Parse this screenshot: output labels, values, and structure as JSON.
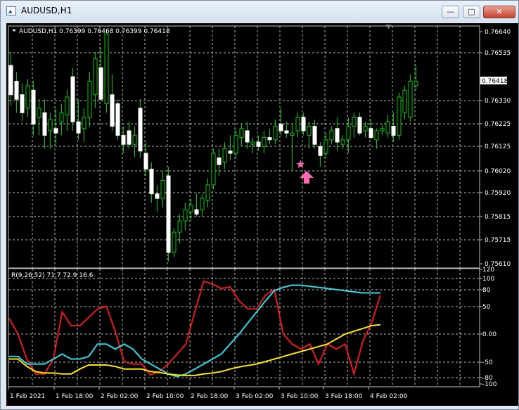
{
  "window": {
    "title": "AUDUSD,H1",
    "minimize_glyph": "—",
    "maximize_glyph": "□",
    "close_glyph": "✕"
  },
  "price_panel": {
    "header": "AUDUSD,H1  0.76399 0.76468 0.76399 0.76418",
    "price_ticks": [
      "0.76640",
      "0.76535",
      "0.76330",
      "0.76225",
      "0.76125",
      "0.76020",
      "0.75920",
      "0.75815",
      "0.75715",
      "0.75610"
    ],
    "current_price": "0.76418",
    "marker_icons": [
      "star-icon",
      "up-arrow-icon"
    ]
  },
  "indicator_panel": {
    "header": "R(9,26,52) 71.7 72.9 16.6",
    "ticks": [
      "120",
      "100",
      "80",
      "50",
      "0.00",
      "-50",
      "-80",
      "-100"
    ],
    "colors": {
      "fast": "#e41a1c",
      "medium": "#33d6e6",
      "slow": "#ffe600"
    }
  },
  "time_axis": [
    "1 Feb 2021",
    "1 Feb 18:00",
    "2 Feb 02:00",
    "2 Feb 10:00",
    "2 Feb 18:00",
    "3 Feb 02:00",
    "3 Feb 10:00",
    "3 Feb 18:00",
    "4 Feb 02:00"
  ],
  "chart_data": [
    {
      "type": "candlestick",
      "title": "AUDUSD,H1",
      "ylim": [
        0.7561,
        0.7664
      ],
      "open_high_low_close": [
        [
          0.7649,
          0.7655,
          0.7631,
          0.7636
        ],
        [
          0.7642,
          0.7646,
          0.7628,
          0.7634
        ],
        [
          0.7636,
          0.7641,
          0.7624,
          0.7628
        ],
        [
          0.763,
          0.7643,
          0.7626,
          0.764
        ],
        [
          0.7638,
          0.7642,
          0.7618,
          0.7623
        ],
        [
          0.7626,
          0.7634,
          0.7618,
          0.763
        ],
        [
          0.7628,
          0.7634,
          0.7612,
          0.7618
        ],
        [
          0.762,
          0.7628,
          0.7612,
          0.7625
        ],
        [
          0.7621,
          0.763,
          0.7614,
          0.7619
        ],
        [
          0.7624,
          0.7632,
          0.7618,
          0.7628
        ],
        [
          0.7627,
          0.7638,
          0.762,
          0.7635
        ],
        [
          0.7644,
          0.7648,
          0.762,
          0.7624
        ],
        [
          0.7624,
          0.7634,
          0.7616,
          0.7619
        ],
        [
          0.7621,
          0.763,
          0.7615,
          0.7626
        ],
        [
          0.7626,
          0.7646,
          0.7622,
          0.7642
        ],
        [
          0.7636,
          0.7655,
          0.763,
          0.7652
        ],
        [
          0.7648,
          0.7657,
          0.7633,
          0.7634
        ],
        [
          0.7632,
          0.7665,
          0.7628,
          0.7663
        ],
        [
          0.7636,
          0.7645,
          0.762,
          0.7622
        ],
        [
          0.7632,
          0.7634,
          0.7616,
          0.7618
        ],
        [
          0.7618,
          0.7622,
          0.761,
          0.7614
        ],
        [
          0.762,
          0.7624,
          0.7612,
          0.7614
        ],
        [
          0.7614,
          0.7622,
          0.7608,
          0.7618
        ],
        [
          0.763,
          0.7634,
          0.7608,
          0.7611
        ],
        [
          0.761,
          0.7615,
          0.76,
          0.7603
        ],
        [
          0.7603,
          0.7606,
          0.7588,
          0.7592
        ],
        [
          0.7592,
          0.7596,
          0.7584,
          0.759
        ],
        [
          0.759,
          0.7602,
          0.7586,
          0.7598
        ],
        [
          0.76,
          0.7604,
          0.7562,
          0.7566
        ],
        [
          0.7566,
          0.7577,
          0.7564,
          0.7575
        ],
        [
          0.7575,
          0.7583,
          0.757,
          0.758
        ],
        [
          0.758,
          0.7588,
          0.7576,
          0.7585
        ],
        [
          0.7584,
          0.759,
          0.758,
          0.7587
        ],
        [
          0.7585,
          0.7592,
          0.7582,
          0.7583
        ],
        [
          0.7585,
          0.7592,
          0.7582,
          0.759
        ],
        [
          0.7589,
          0.7599,
          0.7586,
          0.7596
        ],
        [
          0.7596,
          0.7612,
          0.7594,
          0.761
        ],
        [
          0.7608,
          0.7612,
          0.76,
          0.7605
        ],
        [
          0.7606,
          0.7615,
          0.7603,
          0.7612
        ],
        [
          0.7611,
          0.7618,
          0.7607,
          0.761
        ],
        [
          0.761,
          0.7621,
          0.7608,
          0.7618
        ],
        [
          0.7617,
          0.7623,
          0.7613,
          0.7621
        ],
        [
          0.762,
          0.7624,
          0.7612,
          0.7615
        ],
        [
          0.7614,
          0.7617,
          0.761,
          0.7615
        ],
        [
          0.7615,
          0.7618,
          0.7611,
          0.7613
        ],
        [
          0.7613,
          0.762,
          0.761,
          0.7617
        ],
        [
          0.7617,
          0.7621,
          0.7614,
          0.7616
        ],
        [
          0.7616,
          0.7625,
          0.7614,
          0.7622
        ],
        [
          0.7623,
          0.763,
          0.7618,
          0.762
        ],
        [
          0.762,
          0.7624,
          0.7617,
          0.7619
        ],
        [
          0.7618,
          0.7623,
          0.7602,
          0.7619
        ],
        [
          0.762,
          0.7628,
          0.7617,
          0.7626
        ],
        [
          0.7626,
          0.7628,
          0.7618,
          0.762
        ],
        [
          0.7618,
          0.7624,
          0.7612,
          0.7622
        ],
        [
          0.7622,
          0.7625,
          0.7612,
          0.7614
        ],
        [
          0.7613,
          0.7615,
          0.7604,
          0.7609
        ],
        [
          0.761,
          0.7619,
          0.7608,
          0.7616
        ],
        [
          0.7616,
          0.7622,
          0.7614,
          0.762
        ],
        [
          0.7621,
          0.7626,
          0.7611,
          0.7615
        ],
        [
          0.7614,
          0.7618,
          0.7612,
          0.7616
        ],
        [
          0.7616,
          0.7626,
          0.761,
          0.7622
        ],
        [
          0.7622,
          0.7628,
          0.7617,
          0.7626
        ],
        [
          0.7626,
          0.7628,
          0.7618,
          0.7619
        ],
        [
          0.762,
          0.7624,
          0.7617,
          0.7622
        ],
        [
          0.7621,
          0.7625,
          0.7616,
          0.7617
        ],
        [
          0.7616,
          0.7621,
          0.7612,
          0.762
        ],
        [
          0.762,
          0.7623,
          0.7618,
          0.7621
        ],
        [
          0.7619,
          0.7627,
          0.7617,
          0.7624
        ],
        [
          0.7622,
          0.7628,
          0.7615,
          0.7618
        ],
        [
          0.7618,
          0.7637,
          0.7616,
          0.7635
        ],
        [
          0.7628,
          0.764,
          0.7625,
          0.7638
        ],
        [
          0.7626,
          0.7645,
          0.7624,
          0.7642
        ],
        [
          0.764,
          0.7649,
          0.7638,
          0.7642
        ]
      ]
    },
    {
      "type": "line",
      "title": "R(9,26,52) 71.7 72.9 16.6",
      "ylim": [
        -100,
        120
      ],
      "series": [
        {
          "values": [
            28,
            0,
            -50,
            -80,
            -80,
            -50,
            40,
            15,
            15,
            30,
            45,
            50,
            5,
            -55,
            -60,
            -60,
            -82,
            -75,
            -60,
            -40,
            -20,
            40,
            95,
            90,
            82,
            85,
            60,
            45,
            45,
            70,
            80,
            0,
            -20,
            -30,
            -20,
            -60,
            -20,
            -30,
            -20,
            -80,
            -15,
            20,
            70
          ]
        },
        {
          "values": [
            -45,
            -45,
            -60,
            -60,
            -60,
            -50,
            -40,
            -50,
            -50,
            -45,
            -20,
            -20,
            -30,
            -20,
            -30,
            -50,
            -60,
            -70,
            -80,
            -85,
            -80,
            -70,
            -60,
            -50,
            -40,
            -20,
            0,
            20,
            40,
            60,
            78,
            84,
            88,
            88,
            86,
            84,
            82,
            80,
            78,
            76,
            74,
            74,
            74
          ]
        },
        {
          "values": [
            -50,
            -50,
            -65,
            -75,
            -78,
            -78,
            -80,
            -80,
            -70,
            -62,
            -62,
            -62,
            -65,
            -70,
            -70,
            -70,
            -75,
            -77,
            -80,
            -82,
            -83,
            -83,
            -80,
            -78,
            -75,
            -70,
            -66,
            -63,
            -60,
            -55,
            -50,
            -45,
            -40,
            -35,
            -30,
            -25,
            -20,
            -10,
            0,
            5,
            10,
            15,
            17
          ]
        }
      ]
    }
  ]
}
